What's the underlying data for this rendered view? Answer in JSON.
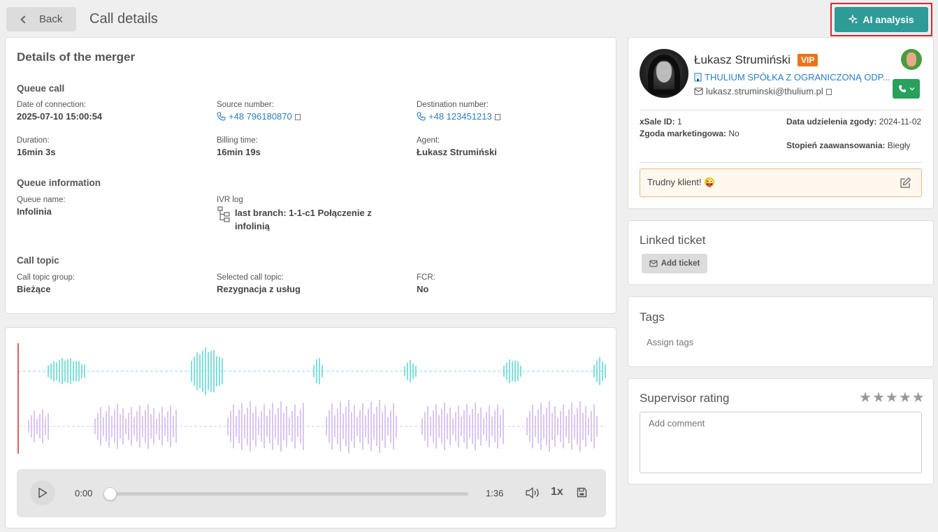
{
  "header": {
    "back_label": "Back",
    "title": "Call details",
    "ai_label": "AI analysis"
  },
  "details": {
    "title": "Details of the merger",
    "queue_call": {
      "heading": "Queue call",
      "date_label": "Date of connection:",
      "date_value": "2025-07-10 15:00:54",
      "source_label": "Source number:",
      "source_value": "+48 796180870",
      "dest_label": "Destination number:",
      "dest_value": "+48 123451213",
      "duration_label": "Duration:",
      "duration_value": "16min 3s",
      "billing_label": "Billing time:",
      "billing_value": "16min 19s",
      "agent_label": "Agent:",
      "agent_value": "Łukasz Strumiński"
    },
    "queue_info": {
      "heading": "Queue information",
      "name_label": "Queue name:",
      "name_value": "Infolinia",
      "ivr_label": "IVR log",
      "ivr_value": "last branch: 1-1-c1 Połączenie z infolinią"
    },
    "call_topic": {
      "heading": "Call topic",
      "group_label": "Call topic group:",
      "group_value": "Bieżące",
      "selected_label": "Selected call topic:",
      "selected_value": "Rezygnacja z usług",
      "fcr_label": "FCR:",
      "fcr_value": "No"
    }
  },
  "player": {
    "current_time": "0:00",
    "total_time": "1:36",
    "speed": "1x",
    "progress": 0,
    "colors": {
      "agent_wave": "#7fe0da",
      "client_wave": "#d9c6f2",
      "cursor": "#e0262d"
    }
  },
  "contact": {
    "name": "Łukasz Strumiński",
    "badge": "VIP",
    "company": "THULIUM SPÓŁKA Z OGRANICZONĄ ODP...",
    "email": "lukasz.struminski@thulium.pl",
    "xsale_label": "xSale ID:",
    "xsale_value": "1",
    "marketing_label": "Zgoda marketingowa:",
    "marketing_value": "No",
    "consent_date_label": "Data udzielenia zgody:",
    "consent_date_value": "2024-11-02",
    "level_label": "Stopień zaawansowania:",
    "level_value": "Biegły",
    "note": "Trudny klient! 😜"
  },
  "ticket": {
    "title": "Linked ticket",
    "add_label": "Add ticket"
  },
  "tags": {
    "title": "Tags",
    "assign_label": "Assign tags"
  },
  "rating": {
    "title": "Supervisor rating",
    "stars": 0,
    "comment_placeholder": "Add comment"
  },
  "colors": {
    "accent": "#2f9b97",
    "link": "#2c7dc1",
    "vip": "#e8731c",
    "call": "#27a15b",
    "highlight_border": "#e0262d"
  }
}
